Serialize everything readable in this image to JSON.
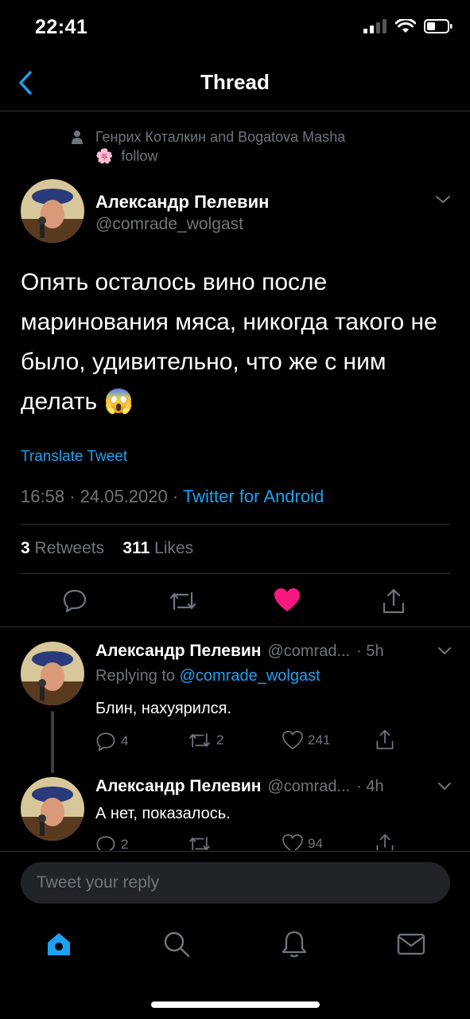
{
  "status": {
    "time": "22:41"
  },
  "header": {
    "title": "Thread"
  },
  "context": {
    "line1": "Генрих Коталкин and Bogatova Masha",
    "line2": "follow"
  },
  "tweet": {
    "name": "Александр Пелевин",
    "handle": "@comrade_wolgast",
    "text": "Опять осталось вино после маринования мяса, никогда такого не было, удивительно, что же с ним делать",
    "emoji": "😱",
    "translate": "Translate Tweet",
    "time": "16:58",
    "date": "24.05.2020",
    "source": "Twitter for Android",
    "sep": "·",
    "retweets_count": "3",
    "retweets_label": "Retweets",
    "likes_count": "311",
    "likes_label": "Likes"
  },
  "replies": [
    {
      "name": "Александр Пелевин",
      "handle": "@comrad...",
      "time": "· 5h",
      "replying_prefix": "Replying to",
      "replying_handle": "@comrade_wolgast",
      "text": "Блин, нахуярился.",
      "replies": "4",
      "retweets": "2",
      "likes": "241"
    },
    {
      "name": "Александр Пелевин",
      "handle": "@comrad...",
      "time": "· 4h",
      "text": "А нет, показалось.",
      "replies": "2",
      "retweets": "",
      "likes": "94"
    }
  ],
  "composer": {
    "placeholder": "Tweet your reply"
  },
  "colors": {
    "accent": "#1da1f2",
    "like": "#f91880",
    "muted": "#6e767d",
    "background": "#000000"
  },
  "icons": {
    "nav": [
      "home-icon",
      "search-icon",
      "bell-icon",
      "mail-icon"
    ],
    "actions": [
      "reply-icon",
      "retweet-icon",
      "like-icon",
      "share-icon"
    ]
  }
}
